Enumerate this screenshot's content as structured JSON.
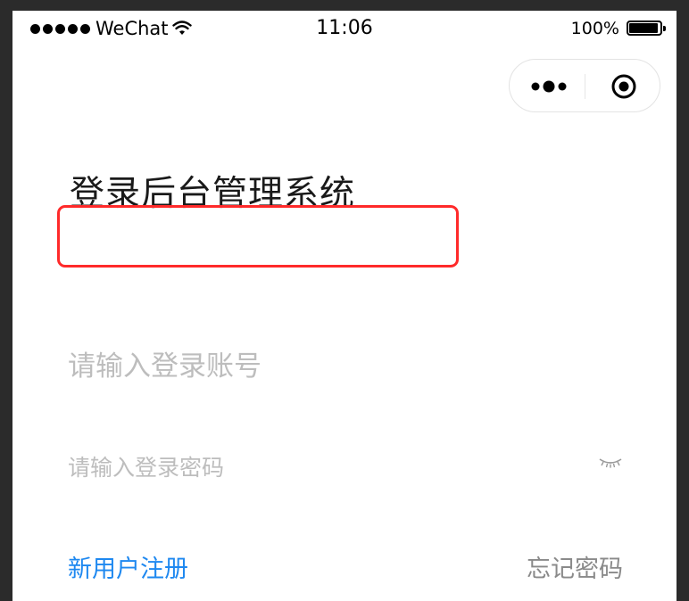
{
  "status_bar": {
    "carrier": "WeChat",
    "time": "11:06",
    "battery": "100%",
    "signal_icon": "signal-dots-icon",
    "wifi_icon": "wifi-icon",
    "battery_icon": "battery-icon"
  },
  "capsule": {
    "more_icon": "more-dots-icon",
    "close_icon": "target-circle-icon"
  },
  "login": {
    "title": "登录后台管理系统",
    "account_placeholder": "请输入登录账号",
    "password_placeholder": "请输入登录密码",
    "eye_icon": "eye-closed-icon",
    "register_label": "新用户注册",
    "forgot_label": "忘记密码"
  },
  "colors": {
    "highlight": "#ff2a2a",
    "link": "#1e88f0",
    "placeholder": "#bdbdbd"
  }
}
